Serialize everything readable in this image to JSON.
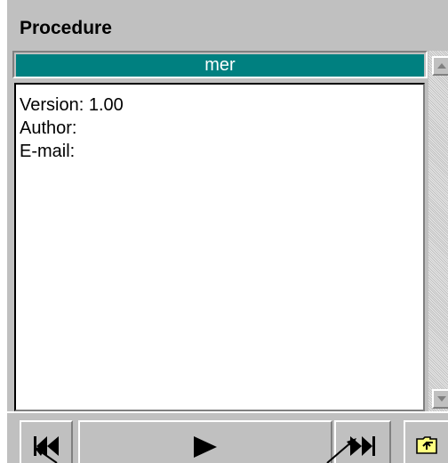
{
  "panel": {
    "title": "Procedure"
  },
  "procedure_list": {
    "selected_item": "mer"
  },
  "description": {
    "lines": [
      "Version: 1.00",
      "Author:",
      "E-mail:"
    ]
  },
  "scrollbar": {
    "up_icon": "triangle-up",
    "down_icon": "triangle-down"
  },
  "toolbar": {
    "buttons": [
      {
        "icon": "rewind-icon"
      },
      {
        "icon": "play-icon"
      },
      {
        "icon": "fast-forward-icon"
      },
      {
        "icon": "folder-up-icon"
      }
    ]
  },
  "colors": {
    "selection_bg": "#008080",
    "panel_bg": "#c0c0c0"
  }
}
